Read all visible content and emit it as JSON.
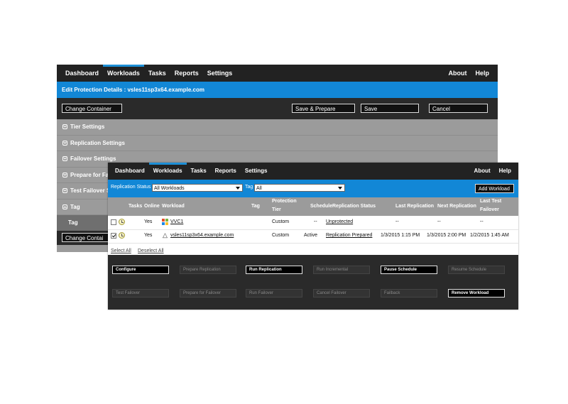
{
  "back": {
    "nav": {
      "items": [
        "Dashboard",
        "Workloads",
        "Tasks",
        "Reports",
        "Settings"
      ],
      "right": [
        "About",
        "Help"
      ],
      "active_index": 1
    },
    "header": "Edit Protection Details : vsles11sp3x64.example.com",
    "toolbar": {
      "change_container": "Change Container",
      "save_prepare": "Save & Prepare",
      "save": "Save",
      "cancel": "Cancel"
    },
    "sections": [
      "Tier Settings",
      "Replication Settings",
      "Failover Settings",
      "Prepare for Fa",
      "Test Failover S",
      "Tag"
    ],
    "tag_label": "Tag",
    "bottom_change_container": "Change Contai"
  },
  "front": {
    "nav": {
      "items": [
        "Dashboard",
        "Workloads",
        "Tasks",
        "Reports",
        "Settings"
      ],
      "right": [
        "About",
        "Help"
      ],
      "active_index": 1
    },
    "filter": {
      "replication_status_label": "Replication Status",
      "replication_status_value": "All Workloads",
      "tag_label": "Tag",
      "tag_value": "All",
      "add_workload": "Add Workload"
    },
    "columns": {
      "tasks": "Tasks",
      "online": "Online",
      "workload": "Workload",
      "tag": "Tag",
      "protection_tier_1": "Protection",
      "protection_tier_2": "Tier",
      "schedule": "Schedule",
      "replication_status": "Replication Status",
      "last_replication": "Last Replication",
      "next_replication": "Next Replication",
      "last_test_failover_1": "Last Test",
      "last_test_failover_2": "Failover"
    },
    "rows": [
      {
        "checked": false,
        "online": "Yes",
        "workload": "VVC1",
        "os": "windows",
        "tier": "Custom",
        "schedule": "--",
        "status": "Unprotected",
        "last_replication": "--",
        "next_replication": "--",
        "last_test_failover": "--"
      },
      {
        "checked": true,
        "online": "Yes",
        "workload": "vsles11sp3x64.example.com",
        "os": "linux",
        "tier": "Custom",
        "schedule": "Active",
        "status": "Replication Prepared",
        "last_replication": "1/3/2015  1:15 PM",
        "next_replication": "1/3/2015  2:00 PM",
        "last_test_failover": "1/2/2015  1:45 AM"
      }
    ],
    "select_all": "Select All",
    "deselect_all": "Deselect All",
    "actions": {
      "configure": "Configure",
      "prepare_replication": "Prepare Replication",
      "run_replication": "Run Replication",
      "run_incremental": "Run Incremental",
      "pause_schedule": "Pause Schedule",
      "resume_schedule": "Resume Schedule",
      "test_failover": "Test Failover",
      "prepare_for_failover": "Prepare for Failover",
      "run_failover": "Run Failover",
      "cancel_failover": "Cancel Failover",
      "failback": "Failback",
      "remove_workload": "Remove Workload"
    }
  },
  "colors": {
    "accent_blue": "#1287d6",
    "nav_bg": "#222222",
    "header_gray": "#9b9b9b",
    "action_bar": "#2a2a2a"
  }
}
